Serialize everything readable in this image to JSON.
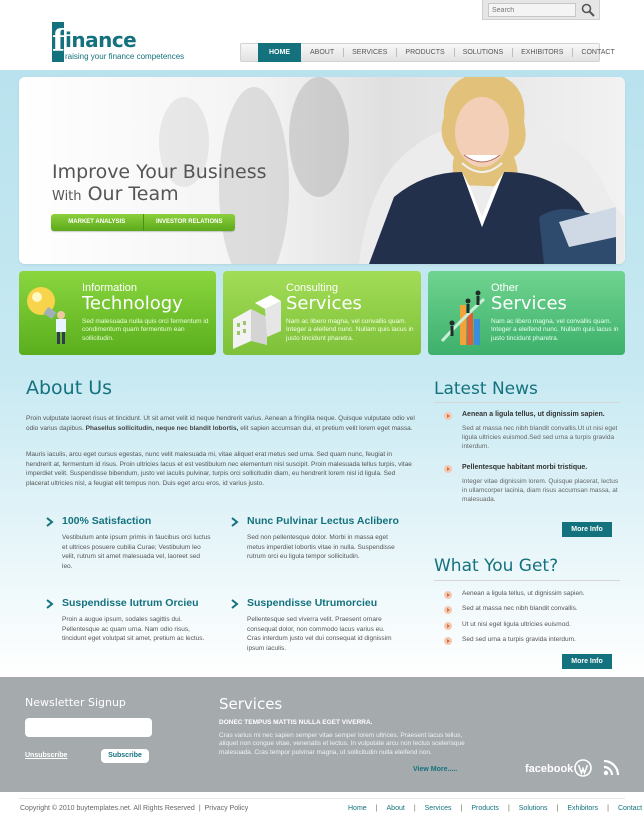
{
  "brand": {
    "letter": "f",
    "word": "inance",
    "tagline": "raising your finance competences"
  },
  "search": {
    "placeholder": "Search"
  },
  "nav": [
    "HOME",
    "ABOUT",
    "SERVICES",
    "PRODUCTS",
    "SOLUTIONS",
    "EXHIBITORS",
    "CONTACT"
  ],
  "hero": {
    "title_line1": "Improve Your Business",
    "title_line2_small": "With",
    "title_line2": " Our Team",
    "buttons": [
      "MARKET ANALYSIS",
      "INVESTOR RELATIONS"
    ]
  },
  "features": [
    {
      "small": "Information",
      "big": "Technology",
      "text": "Sed malesuada nulla quis orci fermentum id condimentum quam fermentum ean sollicitudin.",
      "color": "#6fbd2c"
    },
    {
      "small": "Consulting",
      "big": "Services",
      "text": "Nam ac libero magna, vel convallis quam. Integer a eleifend nunc. Nullam quis lacus in justo tincidunt pharetra.",
      "color": "#8ccc45"
    },
    {
      "small": "Other",
      "big": "Services",
      "text": "Nam ac libero magna, vel convallis quam. Integer a eleifend nunc. Nullam quis lacus in justo tincidunt pharetra.",
      "color": "#47b97b"
    }
  ],
  "about": {
    "title": "About Us",
    "p1_a": "Proin vulputate laoreet risus et tincidunt. Ut sit amet velit id neque hendrerit varius. Aenean a fringilla neque. Quisque vulputate odio vel odio varius dapibus. ",
    "p1_bold": "Phasellus sollicitudin, neque nec blandit lobortis,",
    "p1_b": " elit sapien accumsan dui, et pretium velit lorem eget massa.",
    "p2": "Mauris iaculis, arcu eget cursus egestas, nunc velit malesuada mi, vitae aliquet erat metus sed urna. Sed quam nunc, feugiat in hendrerit at, fermentum id risus. Proin ultricies lacus et est vestibulum nec elementum nisl suscipit. Proin malesuada tellus turpis, vitae imperdiet velit. Suspendisse bibendum, justo vel iaculis pulvinar, turpis orci sollicitudin diam, eu hendrerit lorem nisl id ligula. Sed placerat ultricies nisl, a feugiat elit tempus non. Duis eget arcu eros, id varius justo.",
    "points": [
      {
        "title": "100% Satisfaction",
        "text": "Vestibulum ante ipsum primis in faucibus orci luctus et ultrices posuere cubilia Curae; Vestibulum leo velit, rutrum sit amet malesuada vel, laoreet sed leo."
      },
      {
        "title": "Nunc Pulvinar Lectus Aclibero",
        "text": "Sed non pellentesque dolor. Morbi in massa eget metus imperdiet lobortis vitae in nulla. Suspendisse rutrum orci eu ligula tempor sollicitudin."
      },
      {
        "title": "Suspendisse Iutrum Orcieu",
        "text": "Proin a augue ipsum, sodales sagittis dui. Pellentesque ac quam urna. Nam odio risus, tincidunt eget volutpat sit amet, pretium ac lectus."
      },
      {
        "title": "Suspendisse Utrumorcieu",
        "text": "Pellentesque sed viverra velit. Praesent ornare consequat dolor, non commodo lacus varius eu. Cras interdum justo vel dui consequat id dignissim ipsum iaculis."
      }
    ]
  },
  "news": {
    "title": "Latest News",
    "items": [
      {
        "title": "Aenean a ligula tellus, ut dignissim sapien.",
        "text": "Sed at massa nec nibh blandit convallis.Ut ut nisi eget ligula ultricies euismod.Sed sed urna a turpis gravida interdum."
      },
      {
        "title": "Pellentesque habitant morbi tristique.",
        "text": "Integer vitae dignissim lorem. Quisque placerat, lectus in ullamcorper lacinia, diam risus accumsan massa, at malesuada."
      }
    ],
    "more": "More Info"
  },
  "whatyouget": {
    "title": "What You Get?",
    "items": [
      "Aenean a ligula tellus, ut dignissim sapien.",
      "Sed at massa nec nibh blandit convallis.",
      "Ut ut nisi eget ligula ultricies euismod.",
      "Sed sed urna a turpis gravida interdum."
    ],
    "more": "More Info"
  },
  "newsletter": {
    "title": "Newsletter Signup",
    "unsubscribe": "Unsubscribe",
    "subscribe": "Subscribe"
  },
  "services_footer": {
    "title": "Services",
    "subtitle": "DONEC TEMPUS MATTIS NULLA EGET VIVERRA.",
    "text": "Cras varius mi nec sapien semper vitae semper lorem ultrices. Praesent lacus tellus, aliquet non congue vitae, venenatis et lectus. In vulputate arcu non lectus scelerisque malesuada. Cras tempor pulvinar magna, ut sollicitudin nulla eleifend non.",
    "more": "View More....."
  },
  "social": {
    "facebook": "facebook"
  },
  "footer": {
    "copyright": "Copyright © 2010 buytemplates.net. All Rights Reserved",
    "sep": "|",
    "privacy": "Privacy Policy",
    "nav": [
      "Home",
      "About",
      "Services",
      "Products",
      "Solutions",
      "Exhibitors",
      "Contact"
    ]
  },
  "colors": {
    "brand": "#14727e",
    "green": "#6fbd2c",
    "footer": "#a5aaad"
  }
}
